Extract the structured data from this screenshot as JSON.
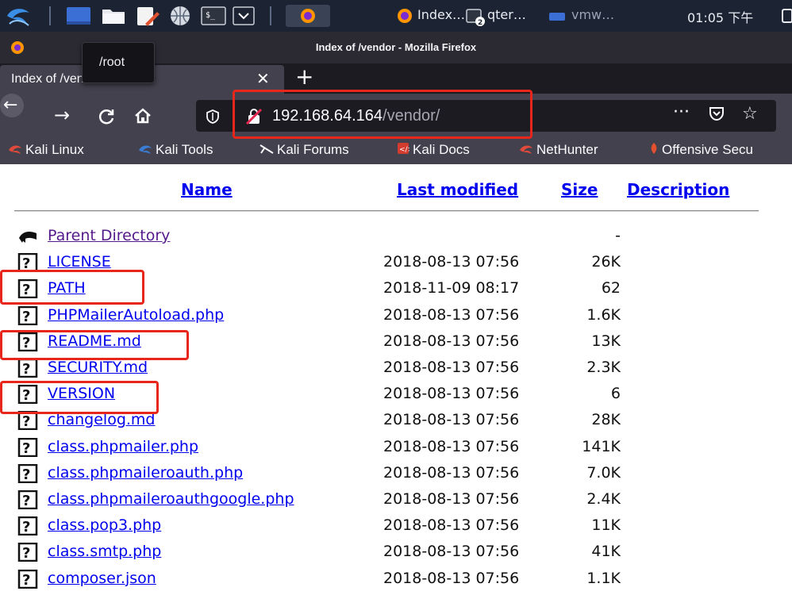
{
  "taskbar": {
    "tasks": [
      {
        "label": "Index…",
        "icon": "firefox-icon"
      },
      {
        "label": "qter…",
        "icon": "terminal-icon"
      },
      {
        "label": "vmw…",
        "icon": "vmware-icon"
      }
    ],
    "clock": "01:05 下午"
  },
  "window": {
    "title": "Index of /vendor - Mozilla Firefox"
  },
  "tab": {
    "label": "Index of /vendor",
    "tooltip": "/root"
  },
  "url": {
    "host": "192.168.64.164",
    "path": "/vendor/"
  },
  "bookmarks": [
    {
      "label": "Kali Linux",
      "icon": "kali-dragon-icon"
    },
    {
      "label": "Kali Tools",
      "icon": "kali-dragon-icon"
    },
    {
      "label": "Kali Forums",
      "icon": "kali-forums-icon"
    },
    {
      "label": "Kali Docs",
      "icon": "kali-docs-icon"
    },
    {
      "label": "NetHunter",
      "icon": "kali-dragon-icon"
    },
    {
      "label": "Offensive Secu",
      "icon": "offsec-icon"
    }
  ],
  "listing": {
    "headers": {
      "name": "Name",
      "last_modified": "Last modified",
      "size": "Size",
      "description": "Description"
    },
    "rows": [
      {
        "name": "Parent Directory",
        "date": "",
        "size": "-",
        "icon": "back-folder-icon",
        "visited": true
      },
      {
        "name": "LICENSE",
        "date": "2018-08-13 07:56",
        "size": "26K",
        "icon": "unknown-file-icon"
      },
      {
        "name": "PATH",
        "date": "2018-11-09 08:17",
        "size": "62",
        "icon": "unknown-file-icon"
      },
      {
        "name": "PHPMailerAutoload.php",
        "date": "2018-08-13 07:56",
        "size": "1.6K",
        "icon": "unknown-file-icon"
      },
      {
        "name": "README.md",
        "date": "2018-08-13 07:56",
        "size": "13K",
        "icon": "unknown-file-icon"
      },
      {
        "name": "SECURITY.md",
        "date": "2018-08-13 07:56",
        "size": "2.3K",
        "icon": "unknown-file-icon"
      },
      {
        "name": "VERSION",
        "date": "2018-08-13 07:56",
        "size": "6",
        "icon": "unknown-file-icon"
      },
      {
        "name": "changelog.md",
        "date": "2018-08-13 07:56",
        "size": "28K",
        "icon": "unknown-file-icon"
      },
      {
        "name": "class.phpmailer.php",
        "date": "2018-08-13 07:56",
        "size": "141K",
        "icon": "unknown-file-icon"
      },
      {
        "name": "class.phpmaileroauth.php",
        "date": "2018-08-13 07:56",
        "size": "7.0K",
        "icon": "unknown-file-icon"
      },
      {
        "name": "class.phpmaileroauthgoogle.php",
        "date": "2018-08-13 07:56",
        "size": "2.4K",
        "icon": "unknown-file-icon"
      },
      {
        "name": "class.pop3.php",
        "date": "2018-08-13 07:56",
        "size": "11K",
        "icon": "unknown-file-icon"
      },
      {
        "name": "class.smtp.php",
        "date": "2018-08-13 07:56",
        "size": "41K",
        "icon": "unknown-file-icon"
      },
      {
        "name": "composer.json",
        "date": "2018-08-13 07:56",
        "size": "1.1K",
        "icon": "unknown-file-icon"
      }
    ]
  },
  "colors": {
    "link": "#0000ee",
    "visited": "#551a8b",
    "annotation": "#e8261c"
  }
}
